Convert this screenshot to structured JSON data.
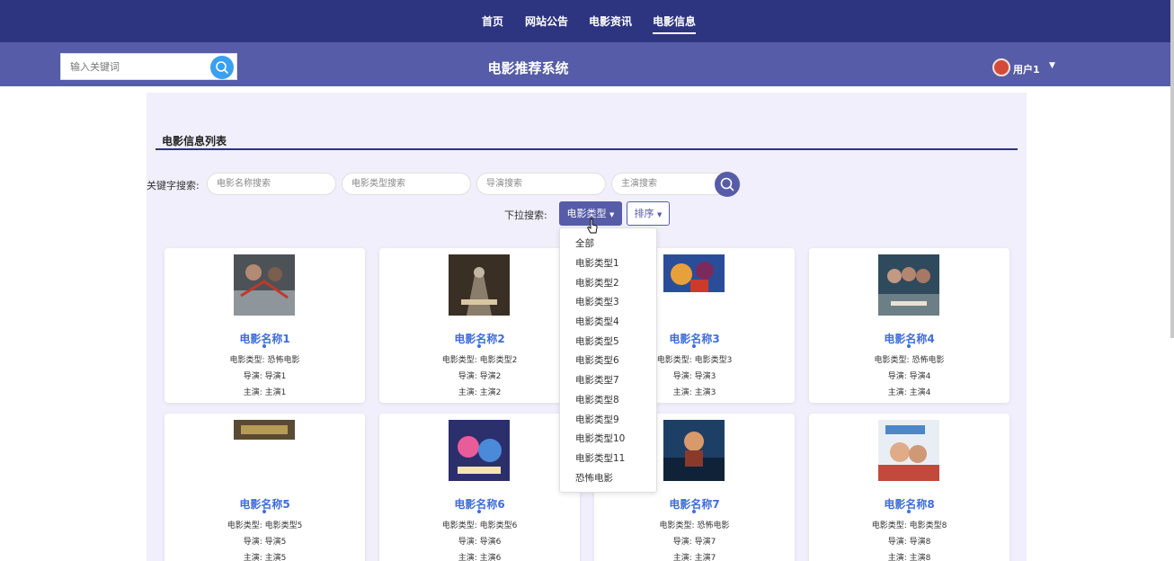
{
  "nav": {
    "items": [
      "首页",
      "网站公告",
      "电影资讯",
      "电影信息"
    ],
    "active": "电影信息"
  },
  "header": {
    "search_placeholder": "输入关键词",
    "title": "电影推荐系统",
    "user": "用户1"
  },
  "section": {
    "title": "电影信息列表"
  },
  "filters": {
    "keyword_label": "关键字搜索:",
    "name_placeholder": "电影名称搜索",
    "type_placeholder": "电影类型搜索",
    "director_placeholder": "导演搜索",
    "actor_placeholder": "主演搜索",
    "dropdown_label": "下拉搜索:",
    "type_button": "电影类型",
    "sort_button": "排序"
  },
  "dropdown_items": [
    "全部",
    "电影类型1",
    "电影类型2",
    "电影类型3",
    "电影类型4",
    "电影类型5",
    "电影类型6",
    "电影类型7",
    "电影类型8",
    "电影类型9",
    "电影类型10",
    "电影类型11",
    "恐怖电影"
  ],
  "movies": [
    {
      "name": "电影名称1",
      "type_line": "电影类型: 恐怖电影",
      "director_line": "导演: 导演1",
      "actor_line": "主演: 主演1"
    },
    {
      "name": "电影名称2",
      "type_line": "电影类型: 电影类型2",
      "director_line": "导演: 导演2",
      "actor_line": "主演: 主演2"
    },
    {
      "name": "电影名称3",
      "type_line": "电影类型: 电影类型3",
      "director_line": "导演: 导演3",
      "actor_line": "主演: 主演3"
    },
    {
      "name": "电影名称4",
      "type_line": "电影类型: 恐怖电影",
      "director_line": "导演: 导演4",
      "actor_line": "主演: 主演4"
    },
    {
      "name": "电影名称5",
      "type_line": "电影类型: 电影类型5",
      "director_line": "导演: 导演5",
      "actor_line": "主演: 主演5"
    },
    {
      "name": "电影名称6",
      "type_line": "电影类型: 电影类型6",
      "director_line": "导演: 导演6",
      "actor_line": "主演: 主演6"
    },
    {
      "name": "电影名称7",
      "type_line": "电影类型: 恐怖电影",
      "director_line": "导演: 导演7",
      "actor_line": "主演: 主演7"
    },
    {
      "name": "电影名称8",
      "type_line": "电影类型: 电影类型8",
      "director_line": "导演: 导演8",
      "actor_line": "主演: 主演8"
    }
  ],
  "colors": {
    "nav_bg": "#2d3480",
    "subheader_bg": "#565ca7",
    "accent": "#565ca7",
    "link": "#3f6ed8",
    "search_btn": "#3aa0f0",
    "content_bg": "#f0effb"
  },
  "icons": {
    "search": "search-icon",
    "caret": "caret-down-icon",
    "cursor": "hand-pointer-icon"
  }
}
